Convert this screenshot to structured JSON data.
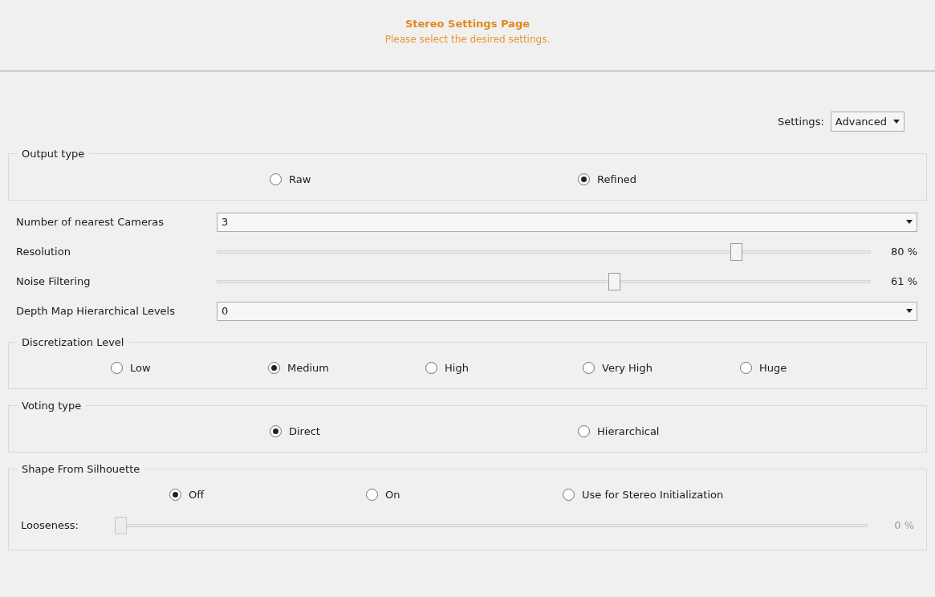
{
  "header": {
    "title": "Stereo Settings Page",
    "subtitle": "Please select the desired settings."
  },
  "settings": {
    "label": "Settings:",
    "value": "Advanced"
  },
  "rows": [
    {
      "kind": "group",
      "title": "Output type",
      "options": [
        {
          "label": "Raw",
          "selected": false
        },
        {
          "label": "Refined",
          "selected": true
        }
      ]
    },
    {
      "kind": "combo",
      "label": "Number of nearest Cameras",
      "value": "3"
    },
    {
      "kind": "slider",
      "label": "Resolution",
      "level": 0.8,
      "reading": "80 %"
    },
    {
      "kind": "slider",
      "label": "Noise Filtering",
      "level": 0.61,
      "reading": "61 %"
    },
    {
      "kind": "combo",
      "label": "Depth Map Hierarchical Levels",
      "value": "0"
    },
    {
      "kind": "group",
      "title": "Discretization Level",
      "options": [
        {
          "label": "Low",
          "selected": false
        },
        {
          "label": "Medium",
          "selected": true
        },
        {
          "label": "High",
          "selected": false
        },
        {
          "label": "Very High",
          "selected": false
        },
        {
          "label": "Huge",
          "selected": false
        }
      ]
    },
    {
      "kind": "group",
      "title": "Voting type",
      "options": [
        {
          "label": "Direct",
          "selected": true
        },
        {
          "label": "Hierarchical",
          "selected": false
        }
      ]
    },
    {
      "kind": "group",
      "title": "Shape From Silhouette",
      "options": [
        {
          "label": "Off",
          "selected": true
        },
        {
          "label": "On",
          "selected": false
        },
        {
          "label": "Use for Stereo Initialization",
          "selected": false
        }
      ],
      "slider": {
        "label": "Looseness:",
        "level": 0,
        "reading": "0 %",
        "disabled": true
      }
    }
  ]
}
